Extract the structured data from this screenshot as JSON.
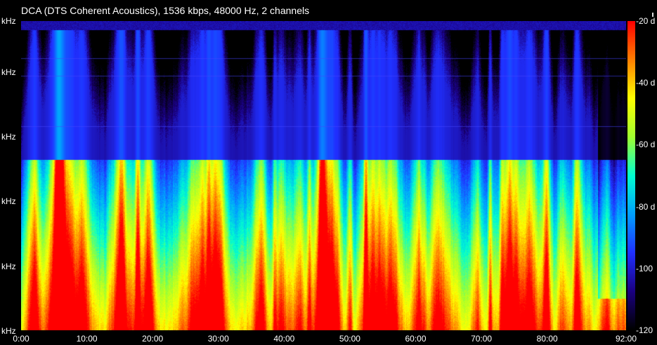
{
  "chart_data": {
    "type": "heatmap",
    "title": "DCA (DTS Coherent Acoustics), 1536 kbps, 48000 Hz, 2 channels",
    "x_axis": {
      "ticks": [
        "0:00",
        "10:00",
        "20:00",
        "30:00",
        "40:00",
        "50:00",
        "60:00",
        "70:00",
        "80:00",
        "92:00"
      ],
      "tick_minutes": [
        0,
        10,
        20,
        30,
        40,
        50,
        60,
        70,
        80,
        92
      ],
      "range_minutes": [
        0,
        92
      ]
    },
    "y_axis": {
      "ticks": [
        "kHz",
        "kHz",
        "kHz",
        "kHz",
        "kHz",
        "kHz"
      ],
      "note": "frequency axis, tick numbers not visible"
    },
    "colorbar": {
      "unit_labels": [
        "-20 d",
        "-40 d",
        "-60 d",
        "-80 d",
        "-100",
        "-120"
      ],
      "values_db": [
        -20,
        -40,
        -60,
        -80,
        -100,
        -120
      ],
      "range_db": [
        -120,
        -20
      ],
      "colors": [
        "#000000",
        "#1a0080",
        "#2030ff",
        "#00a0ff",
        "#00ffd0",
        "#a0ff30",
        "#ffff00",
        "#ff8000",
        "#ff0000"
      ]
    },
    "legend": "colorbar right",
    "grid": false
  }
}
